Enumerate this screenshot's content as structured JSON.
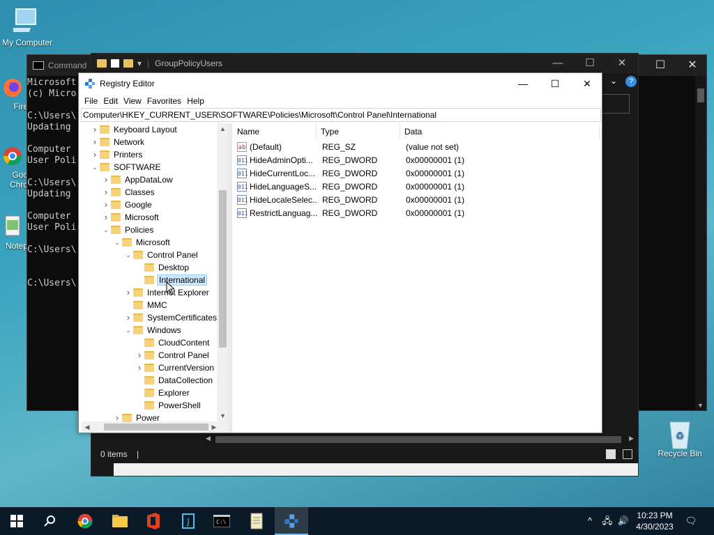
{
  "desktop": {
    "icons": [
      {
        "label": "My Computer"
      },
      {
        "label": "Fire"
      },
      {
        "label": "Goo\nChro"
      },
      {
        "label": "Notep"
      },
      {
        "label": "Recycle Bin"
      }
    ]
  },
  "cmd": {
    "title": "Command",
    "lines": [
      "Microsoft",
      "(c) Micro",
      "",
      "C:\\Users\\",
      "Updating",
      "",
      "Computer",
      "User Poli",
      "",
      "C:\\Users\\",
      "Updating",
      "",
      "Computer",
      "User Poli",
      "",
      "C:\\Users\\",
      "",
      "",
      "C:\\Users\\"
    ]
  },
  "explorer": {
    "title": "GroupPolicyUsers",
    "status": "0 items"
  },
  "regedit": {
    "title": "Registry Editor",
    "menu": [
      "File",
      "Edit",
      "View",
      "Favorites",
      "Help"
    ],
    "address": "Computer\\HKEY_CURRENT_USER\\SOFTWARE\\Policies\\Microsoft\\Control Panel\\International",
    "tree": [
      {
        "label": "Keyboard Layout",
        "depth": 1,
        "state": "collapsed"
      },
      {
        "label": "Network",
        "depth": 1,
        "state": "collapsed"
      },
      {
        "label": "Printers",
        "depth": 1,
        "state": "collapsed"
      },
      {
        "label": "SOFTWARE",
        "depth": 1,
        "state": "expanded"
      },
      {
        "label": "AppDataLow",
        "depth": 2,
        "state": "collapsed"
      },
      {
        "label": "Classes",
        "depth": 2,
        "state": "collapsed"
      },
      {
        "label": "Google",
        "depth": 2,
        "state": "collapsed"
      },
      {
        "label": "Microsoft",
        "depth": 2,
        "state": "collapsed"
      },
      {
        "label": "Policies",
        "depth": 2,
        "state": "expanded"
      },
      {
        "label": "Microsoft",
        "depth": 3,
        "state": "expanded"
      },
      {
        "label": "Control Panel",
        "depth": 4,
        "state": "expanded"
      },
      {
        "label": "Desktop",
        "depth": 5,
        "state": "leaf"
      },
      {
        "label": "International",
        "depth": 5,
        "state": "leaf",
        "selected": true
      },
      {
        "label": "Internet Explorer",
        "depth": 4,
        "state": "collapsed"
      },
      {
        "label": "MMC",
        "depth": 4,
        "state": "leaf"
      },
      {
        "label": "SystemCertificates",
        "depth": 4,
        "state": "collapsed"
      },
      {
        "label": "Windows",
        "depth": 4,
        "state": "expanded"
      },
      {
        "label": "CloudContent",
        "depth": 5,
        "state": "leaf"
      },
      {
        "label": "Control Panel",
        "depth": 5,
        "state": "collapsed"
      },
      {
        "label": "CurrentVersion",
        "depth": 5,
        "state": "collapsed"
      },
      {
        "label": "DataCollection",
        "depth": 5,
        "state": "leaf"
      },
      {
        "label": "Explorer",
        "depth": 5,
        "state": "leaf"
      },
      {
        "label": "PowerShell",
        "depth": 5,
        "state": "leaf"
      },
      {
        "label": "Power",
        "depth": 3,
        "state": "collapsed"
      }
    ],
    "columns": [
      "Name",
      "Type",
      "Data"
    ],
    "values": [
      {
        "icon": "string",
        "name": "(Default)",
        "type": "REG_SZ",
        "data": "(value not set)"
      },
      {
        "icon": "dword",
        "name": "HideAdminOpti...",
        "type": "REG_DWORD",
        "data": "0x00000001 (1)"
      },
      {
        "icon": "dword",
        "name": "HideCurrentLoc...",
        "type": "REG_DWORD",
        "data": "0x00000001 (1)"
      },
      {
        "icon": "dword",
        "name": "HideLanguageS...",
        "type": "REG_DWORD",
        "data": "0x00000001 (1)"
      },
      {
        "icon": "dword",
        "name": "HideLocaleSelec...",
        "type": "REG_DWORD",
        "data": "0x00000001 (1)"
      },
      {
        "icon": "dword",
        "name": "RestrictLanguag...",
        "type": "REG_DWORD",
        "data": "0x00000001 (1)"
      }
    ]
  },
  "taskbar": {
    "time": "10:23 PM",
    "date": "4/30/2023"
  },
  "colors": {
    "selection": "#cce8ff",
    "folder": "#f6d378",
    "taskbar": "#0a1a28"
  }
}
